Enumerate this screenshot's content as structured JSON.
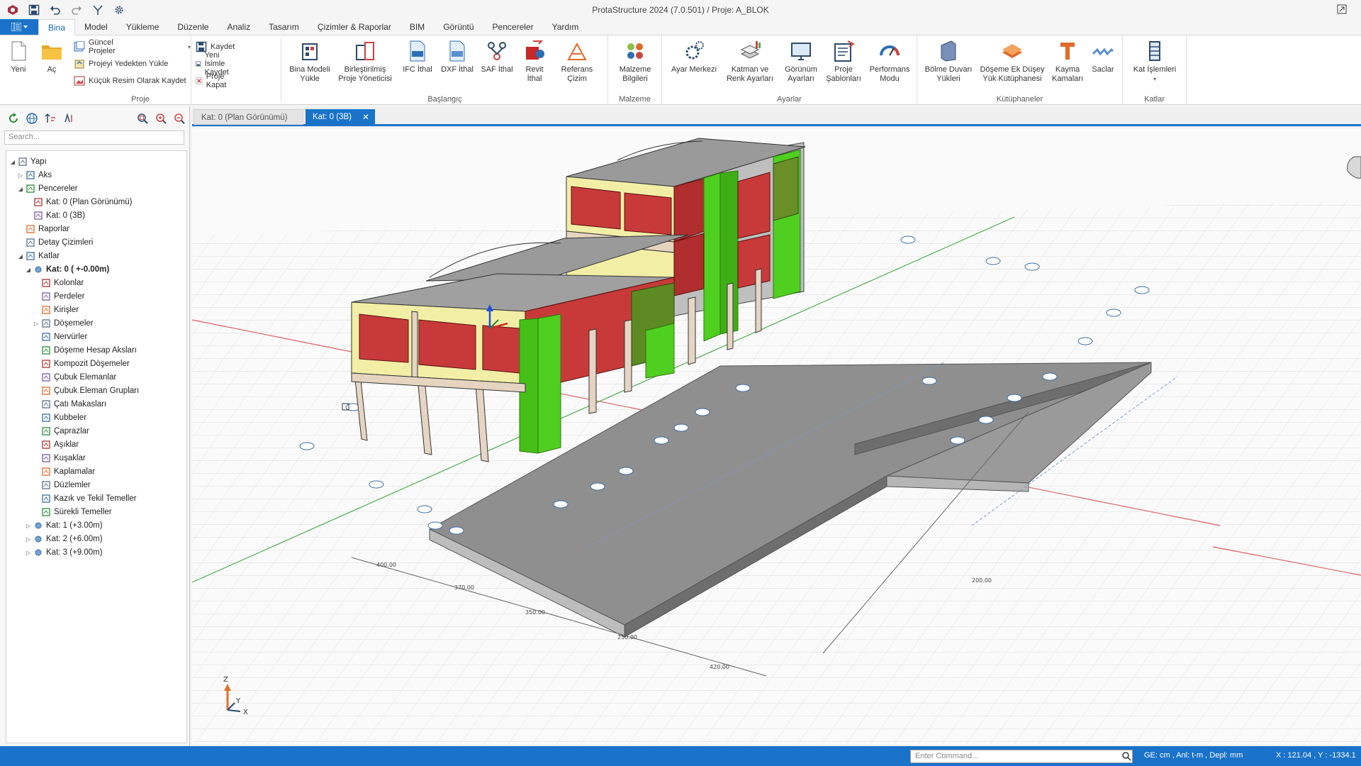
{
  "window": {
    "title": "ProtaStructure 2024 (7.0.501) / Proje: A_BLOK"
  },
  "menu": {
    "tabs": [
      "Bina",
      "Model",
      "Yükleme",
      "Düzenle",
      "Analiz",
      "Tasarım",
      "Çizimler & Raporlar",
      "BIM",
      "Görüntü",
      "Pencereler",
      "Yardım"
    ],
    "active": "Bina"
  },
  "ribbon": {
    "proje": {
      "name": "Proje",
      "yeni": "Yeni",
      "ac": "Aç",
      "guncel": "Güncel Projeler",
      "yedek": "Projeyi Yedekten Yükle",
      "kucuk": "Küçük Resim Olarak Kaydet",
      "kaydet": "Kaydet",
      "yeni_isim": "Yeni İsimle Kaydet",
      "kapat": "Proje Kapat"
    },
    "baslangic": {
      "name": "Başlangıç",
      "bina_modeli": [
        "Bina Modeli",
        "Yükle"
      ],
      "birlestirilmis": [
        "Birleştirilmiş",
        "Proje Yöneticisi"
      ],
      "ifc": [
        "IFC İthal"
      ],
      "dxf": [
        "DXF İthal"
      ],
      "saf": [
        "SAF İthal"
      ],
      "revit": [
        "Revit",
        "İthal"
      ],
      "referans": [
        "Referans",
        "Çizim"
      ]
    },
    "malzeme": {
      "name": "Malzeme",
      "bilgi": [
        "Malzeme",
        "Bilgileri"
      ]
    },
    "ayarlar": {
      "name": "Ayarlar",
      "ayar": [
        "Ayar Merkezi"
      ],
      "katman": [
        "Katman ve",
        "Renk Ayarları"
      ],
      "gorunum": [
        "Görünüm",
        "Ayarları"
      ],
      "proje_sablon": [
        "Proje",
        "Şablonları"
      ],
      "performans": [
        "Performans",
        "Modu"
      ]
    },
    "kutuphaneler": {
      "name": "Kütüphaneler",
      "bolme": [
        "Bölme Duvarı",
        "Yükleri"
      ],
      "doseme": [
        "Döşeme Ek Düşey",
        "Yük Kütüphanesi"
      ],
      "kayma": [
        "Kayma",
        "Kamaları"
      ],
      "saclar": [
        "Saclar"
      ]
    },
    "katlar": {
      "name": "Katlar",
      "islem": [
        "Kat İşlemleri"
      ]
    }
  },
  "panel": {
    "search_placeholder": "Search...",
    "tree": [
      {
        "label": "Yapı",
        "level": 0,
        "arrow": "down"
      },
      {
        "label": "Aks",
        "level": 1,
        "arrow": "right"
      },
      {
        "label": "Pencereler",
        "level": 1,
        "arrow": "down"
      },
      {
        "label": "Kat: 0 (Plan Görünümü)",
        "level": 2,
        "arrow": ""
      },
      {
        "label": "Kat: 0 (3B)",
        "level": 2,
        "arrow": ""
      },
      {
        "label": "Raporlar",
        "level": 1,
        "arrow": ""
      },
      {
        "label": "Detay Çizimleri",
        "level": 1,
        "arrow": ""
      },
      {
        "label": "Katlar",
        "level": 1,
        "arrow": "down"
      },
      {
        "label": "Kat: 0 ( +-0.00m)",
        "level": 2,
        "arrow": "down",
        "bold": true
      },
      {
        "label": "Kolonlar",
        "level": 3,
        "arrow": ""
      },
      {
        "label": "Perdeler",
        "level": 3,
        "arrow": ""
      },
      {
        "label": "Kirişler",
        "level": 3,
        "arrow": ""
      },
      {
        "label": "Döşemeler",
        "level": 3,
        "arrow": "right"
      },
      {
        "label": "Nervürler",
        "level": 3,
        "arrow": ""
      },
      {
        "label": "Döşeme Hesap Aksları",
        "level": 3,
        "arrow": ""
      },
      {
        "label": "Kompozit Döşemeler",
        "level": 3,
        "arrow": ""
      },
      {
        "label": "Çubuk Elemanlar",
        "level": 3,
        "arrow": ""
      },
      {
        "label": "Çubuk Eleman Grupları",
        "level": 3,
        "arrow": ""
      },
      {
        "label": "Çatı Makasları",
        "level": 3,
        "arrow": ""
      },
      {
        "label": "Kubbeler",
        "level": 3,
        "arrow": ""
      },
      {
        "label": "Çaprazlar",
        "level": 3,
        "arrow": ""
      },
      {
        "label": "Aşıklar",
        "level": 3,
        "arrow": ""
      },
      {
        "label": "Kuşaklar",
        "level": 3,
        "arrow": ""
      },
      {
        "label": "Kaplamalar",
        "level": 3,
        "arrow": ""
      },
      {
        "label": "Düzlemler",
        "level": 3,
        "arrow": ""
      },
      {
        "label": "Kazık ve Tekil Temeller",
        "level": 3,
        "arrow": ""
      },
      {
        "label": "Sürekli Temeller",
        "level": 3,
        "arrow": ""
      },
      {
        "label": "Kat: 1 (+3.00m)",
        "level": 2,
        "arrow": "right"
      },
      {
        "label": "Kat: 2 (+6.00m)",
        "level": 2,
        "arrow": "right"
      },
      {
        "label": "Kat: 3 (+9.00m)",
        "level": 2,
        "arrow": "right"
      }
    ]
  },
  "viewport": {
    "tab1": "Kat: 0 (Plan Görünümü)",
    "tab2": "Kat: 0 (3B)",
    "axis_x": "X",
    "axis_y": "Y",
    "axis_z": "Z",
    "dims": [
      "400.00",
      "370.00",
      "350.00",
      "250.00",
      "420.00",
      "200.00"
    ]
  },
  "status": {
    "command_placeholder": "Enter Command...",
    "units": "GE: cm , Anl: t-m , Depl: mm",
    "coords": "X : 121.04 , Y : -1334.1"
  },
  "colors": {
    "accent": "#1a73c9",
    "wall_red": "#c83a3a",
    "shear_green": "#4fcf1f",
    "column": "#e6d5c4",
    "beam": "#f3efa0",
    "slab": "#9a9a9a"
  }
}
